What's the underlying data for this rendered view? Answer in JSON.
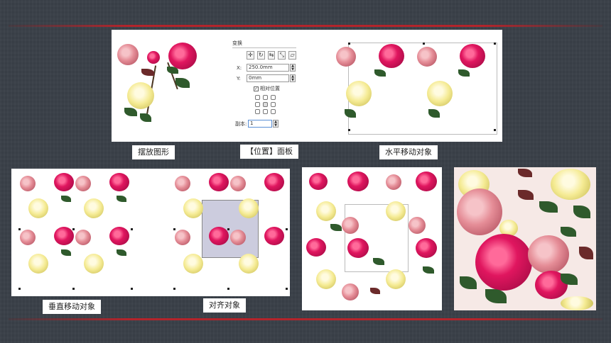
{
  "captions": {
    "arrange": "摆放图形",
    "position_panel": "【位置】面板",
    "move_horizontal": "水平移动对象",
    "move_vertical": "垂直移动对象",
    "align": "对齐对象"
  },
  "transform_panel": {
    "title": "变换",
    "tool_icons": [
      "move-icon",
      "rotate-icon",
      "mirror-icon",
      "scale-icon",
      "skew-icon"
    ],
    "x_label": "X:",
    "x_value": "250.0mm",
    "y_label": "Y:",
    "y_value": "0mm",
    "relative_label": "相对位置",
    "relative_checked": true,
    "copies_label": "副本:",
    "copies_value": "1"
  },
  "colors": {
    "rule": "#b3242b",
    "background": "#3a4048",
    "rose_red": "#e0165f",
    "rose_pink": "#e58d97",
    "rose_yellow": "#f5eb94",
    "leaf": "#2f5a2c"
  }
}
